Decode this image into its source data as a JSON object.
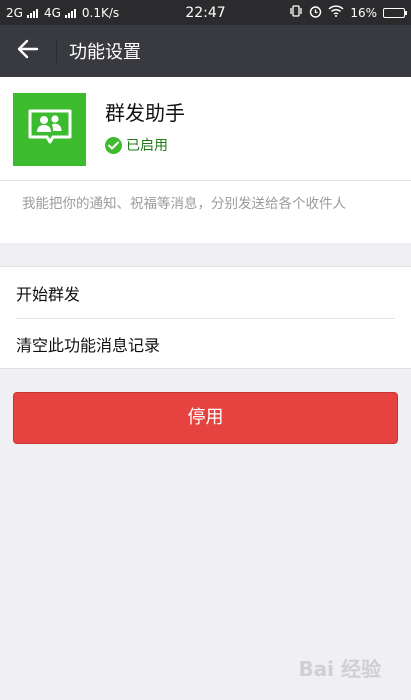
{
  "status_bar": {
    "network1": "2G",
    "network2": "4G",
    "speed": "0.1K/s",
    "time": "22:47",
    "battery_percent": "16%",
    "battery_level": 0.16
  },
  "nav": {
    "title": "功能设置"
  },
  "app": {
    "name": "群发助手",
    "status": "已启用",
    "icon_color": "#3dbb2f",
    "description": "我能把你的通知、祝福等消息，分别发送给各个收件人"
  },
  "menu": {
    "items": [
      {
        "label": "开始群发"
      },
      {
        "label": "清空此功能消息记录"
      }
    ]
  },
  "actions": {
    "disable_label": "停用",
    "disable_color": "#e64340"
  },
  "watermark": "Bai 经验"
}
